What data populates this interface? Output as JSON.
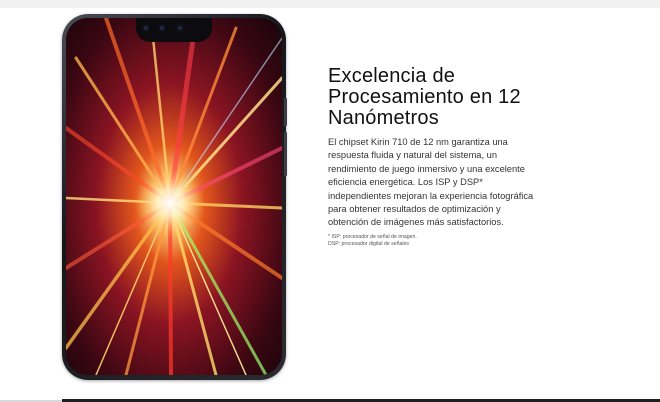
{
  "feature": {
    "title_line1": "Excelencia de",
    "title_line2": "Procesamiento en 12",
    "title_line3": "Nanómetros",
    "body_lines": [
      "El chipset Kirin 710 de 12 nm garantiza una",
      "respuesta fluida y natural del sistema, un",
      "rendimiento de juego inmersivo y una excelente",
      "eficiencia energética. Los ISP y DSP*",
      "independientes mejoran la experiencia fotográfica",
      "para obtener resultados de optimización y",
      "obtención de imágenes más satisfactorios."
    ],
    "footnote_isp": "* ISP: procesador de señal de imagen.",
    "footnote_dsp": "DSP: procesador digital de señales"
  },
  "image": {
    "subject": "smartphone-with-light-burst-wallpaper"
  },
  "colors": {
    "background": "#ffffff",
    "text": "#111111",
    "frame": "#1f1f1f"
  }
}
